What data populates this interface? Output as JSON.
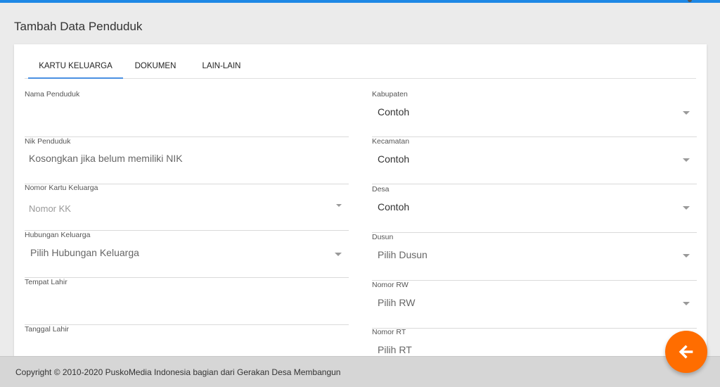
{
  "page": {
    "title": "Tambah Data Penduduk"
  },
  "tabs": [
    {
      "label": "KARTU KELUARGA",
      "active": true
    },
    {
      "label": "DOKUMEN",
      "active": false
    },
    {
      "label": "LAIN-LAIN",
      "active": false
    }
  ],
  "left_fields": [
    {
      "label": "Nama Penduduk",
      "value": ""
    },
    {
      "label": "Nik Penduduk",
      "placeholder": "Kosongkan jika belum memiliki NIK"
    },
    {
      "label": "Nomor Kartu Keluarga",
      "placeholder": "Nomor KK"
    },
    {
      "label": "Hubungan Keluarga",
      "value": "Pilih Hubungan Keluarga"
    },
    {
      "label": "Tempat Lahir",
      "value": ""
    },
    {
      "label": "Tanggal Lahir",
      "value": ""
    }
  ],
  "right_fields": [
    {
      "label": "Kabupaten",
      "value": "Contoh"
    },
    {
      "label": "Kecamatan",
      "value": "Contoh"
    },
    {
      "label": "Desa",
      "value": "Contoh"
    },
    {
      "label": "Dusun",
      "value": "Pilih Dusun"
    },
    {
      "label": "Nomor RW",
      "value": "Pilih RW"
    },
    {
      "label": "Nomor RT",
      "value": "Pilih RT"
    }
  ],
  "footer": {
    "text": "Copyright © 2010-2020 PuskoMedia Indonesia bagian dari Gerakan Desa Membangun"
  },
  "fab": {
    "icon": "arrow-left-icon",
    "color": "#ff6d00"
  },
  "colors": {
    "accent": "#4a90e2",
    "topbar": "#1e88e5"
  }
}
